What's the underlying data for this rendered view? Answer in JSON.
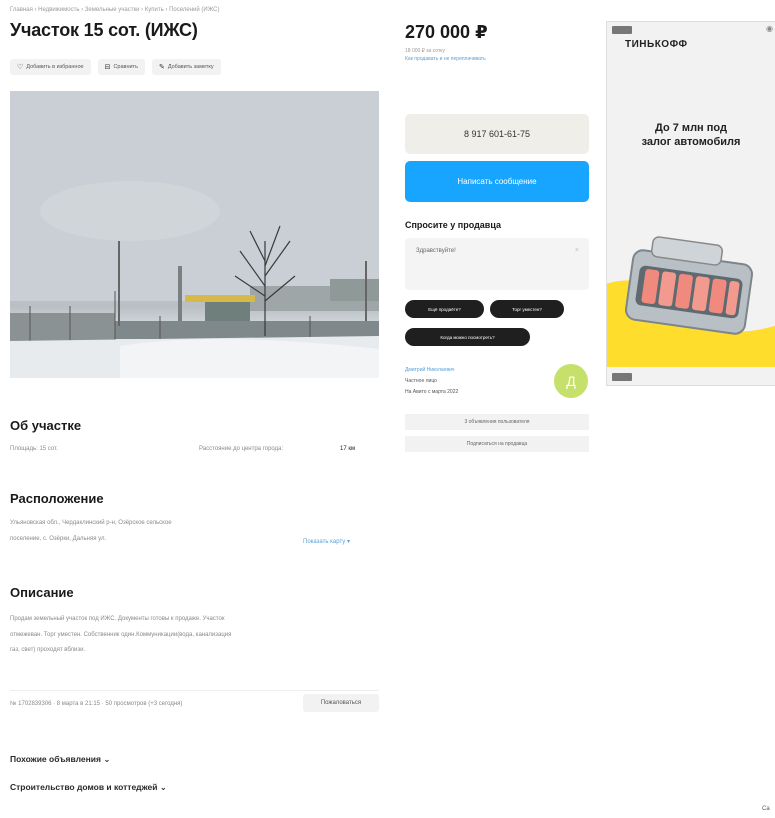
{
  "breadcrumb": "Главная › Недвижимость › Земельные участки › Купить › Поселений (ИЖС)",
  "listing": {
    "title": "Участок 15 сот. (ИЖС)",
    "actions": [
      {
        "icon": "heart-icon",
        "glyph": "♡",
        "label": "Добавить в избранное"
      },
      {
        "icon": "compare-icon",
        "glyph": "⊟",
        "label": "Сравнить"
      },
      {
        "icon": "note-icon",
        "glyph": "✎",
        "label": "Добавить заметку"
      }
    ]
  },
  "about": {
    "heading": "Об участке",
    "area": "Площадь: 15 сот.",
    "distance_label": "Расстояние до центра города:",
    "distance_value": "17 км"
  },
  "location": {
    "heading": "Расположение",
    "address_line1": "Ульяновская обл., Чердаклинский р-н, Озёрское сельское",
    "address_line2": "поселение, с. Озёрки, Дальняя ул.",
    "map_link": "Показать карту ▾"
  },
  "description": {
    "heading": "Описание",
    "line1": "Продам земельный участок под ИЖС. Документы готовы к продаже. Участок",
    "line2": "отмежеван. Торг уместен. Собственник один.Коммуникации(вода, канализация",
    "line3": "газ, свет) проходят вблизи."
  },
  "meta": {
    "text": "№ 1702839306 · 8 марта в 21:15 · 50 просмотров (+3 сегодня)",
    "complain_label": "Пожаловаться"
  },
  "sections": {
    "similar": "Похожие объявления ⌄",
    "construction": "Строительство домов и коттеджей ⌄"
  },
  "sidebar": {
    "price": "270 000 ₽",
    "price_sub": "18 000 ₽ за сотку",
    "price_link": "Как продавать и не переплачивать",
    "phone": "8 917 601-61-75",
    "write_message": "Написать сообщение",
    "ask_title": "Спросите у продавца",
    "ask_placeholder": "Здравствуйте!",
    "quick_questions": [
      "Ещё продаёте?",
      "Торг уместен?",
      "Когда можно посмотреть?"
    ],
    "seller_name": "Дмитрий Николаевич",
    "seller_type": "Частное лицо",
    "seller_since": "На Авито с марта 2022",
    "avatar_letter": "Д",
    "seller_buttons": [
      "3 объявления пользователя",
      "Подписаться на продавца"
    ]
  },
  "ad": {
    "brand": "ТИНЬКОФФ",
    "headline_line1": "До 7 млн под",
    "headline_line2": "залог автомобиля"
  },
  "footer_fragment": "Са",
  "colors": {
    "accent_blue": "#18a5ff",
    "link_blue": "#5a9fd8",
    "avatar_green": "#c5e06b",
    "ad_yellow": "#ffdd2d"
  }
}
